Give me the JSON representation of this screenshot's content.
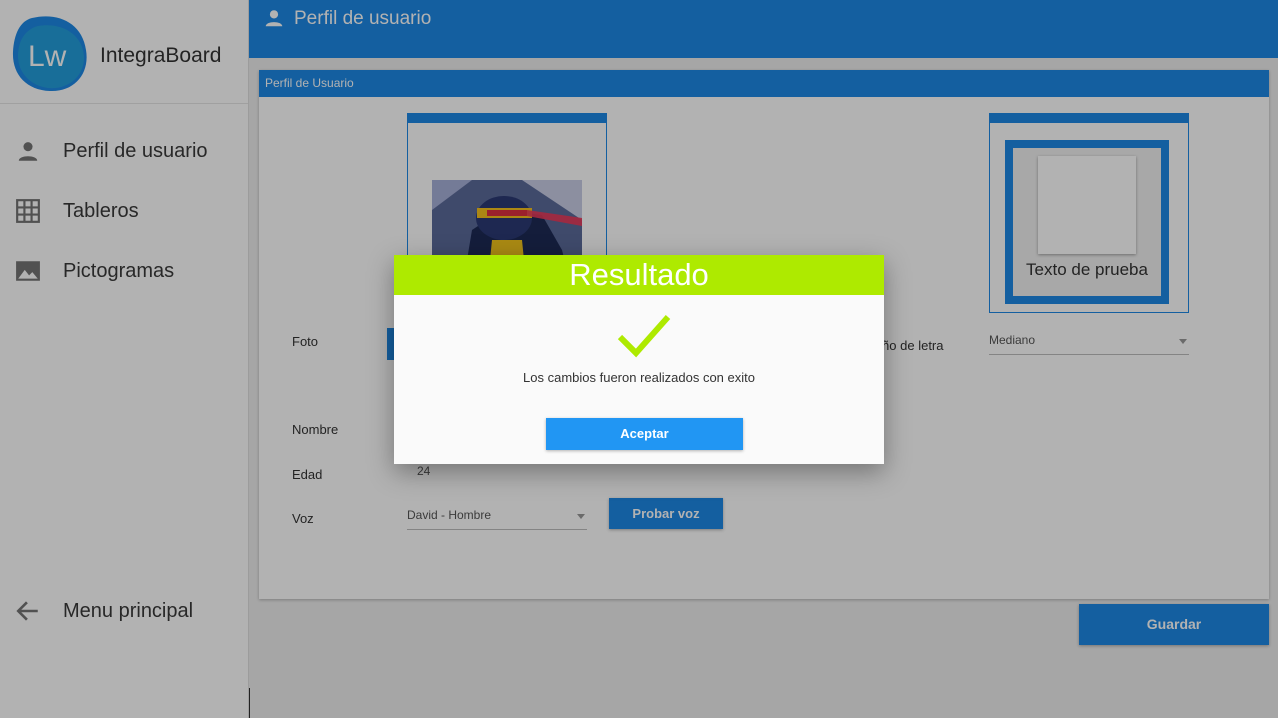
{
  "app": {
    "name": "IntegraBoard",
    "logo_text": "Lw"
  },
  "sidebar": {
    "items": [
      {
        "label": "Perfil de usuario",
        "icon": "person-icon"
      },
      {
        "label": "Tableros",
        "icon": "grid-icon"
      },
      {
        "label": "Pictogramas",
        "icon": "image-icon"
      }
    ],
    "back": {
      "label": "Menu principal",
      "icon": "arrow-left-icon"
    }
  },
  "header": {
    "title": "Perfil de usuario",
    "icon": "person-icon"
  },
  "card": {
    "title": "Perfil de Usuario",
    "fields": {
      "foto_label": "Foto",
      "nombre_label": "Nombre",
      "edad_label": "Edad",
      "edad_value": "24",
      "voz_label": "Voz",
      "voz_value": "David - Hombre",
      "font_size_label": "maño de letra",
      "font_size_value": "Mediano"
    },
    "preview_text": "Texto de prueba",
    "probar_button": "Probar voz"
  },
  "guardar_button": "Guardar",
  "dialog": {
    "title": "Resultado",
    "message": "Los cambios fueron realizados con exito",
    "accept_button": "Aceptar",
    "icon": "checkmark-icon"
  },
  "colors": {
    "primary": "#1e88e5",
    "dialog_header": "#aeea00",
    "accept_button": "#2196f3",
    "check": "#aeea00"
  }
}
